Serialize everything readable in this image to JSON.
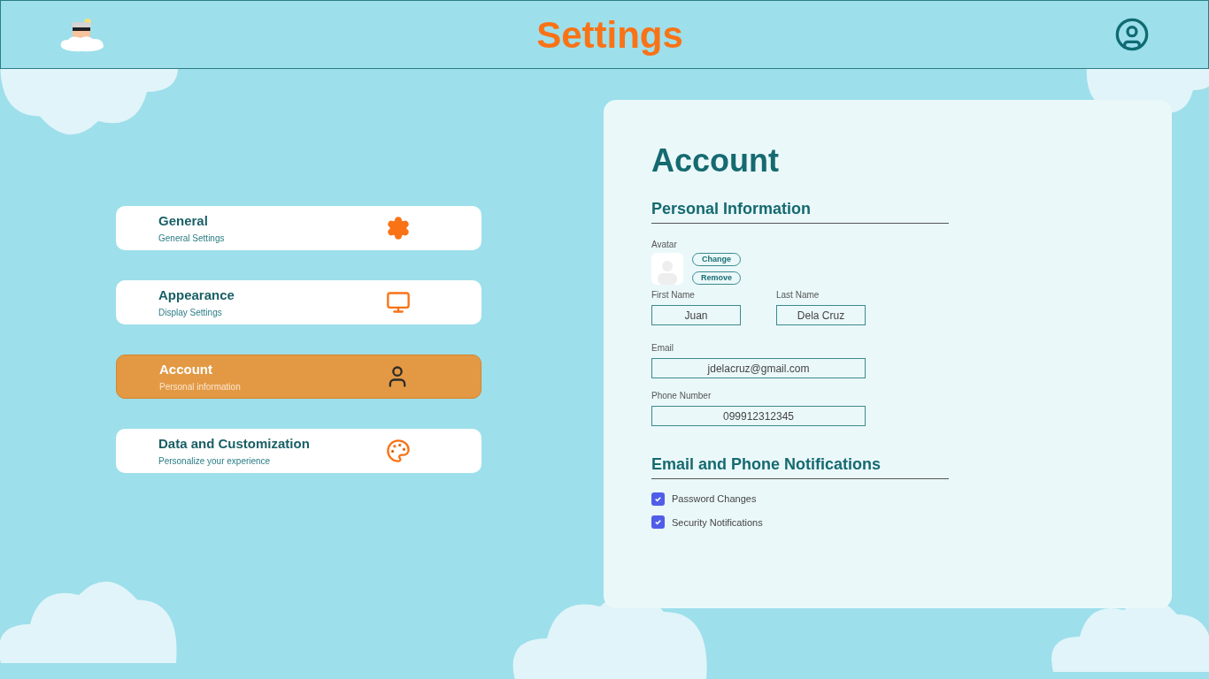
{
  "header": {
    "title": "Settings"
  },
  "menu": [
    {
      "kind": "general",
      "title": "General",
      "subtitle": "General Settings",
      "selected": false
    },
    {
      "kind": "appearance",
      "title": "Appearance",
      "subtitle": "Display Settings",
      "selected": false
    },
    {
      "kind": "account",
      "title": "Account",
      "subtitle": "Personal information",
      "selected": true
    },
    {
      "kind": "data",
      "title": "Data and Customization",
      "subtitle": "Personalize your experience",
      "selected": false
    }
  ],
  "panel": {
    "title": "Account",
    "personal": {
      "heading": "Personal Information",
      "avatar_label": "Avatar",
      "buttons": [
        "Change",
        "Remove"
      ],
      "first_name": {
        "label": "First Name",
        "value": "Juan"
      },
      "last_name": {
        "label": "Last Name",
        "value": "Dela Cruz"
      },
      "email": {
        "label": "Email",
        "value": "jdelacruz@gmail.com"
      },
      "phone": {
        "label": "Phone Number",
        "value": "099912312345"
      }
    },
    "notifications": {
      "heading": "Email and Phone Notifications",
      "options": [
        {
          "label": "Password Changes",
          "checked": true
        },
        {
          "label": "Security Notifications",
          "checked": true
        }
      ]
    }
  }
}
